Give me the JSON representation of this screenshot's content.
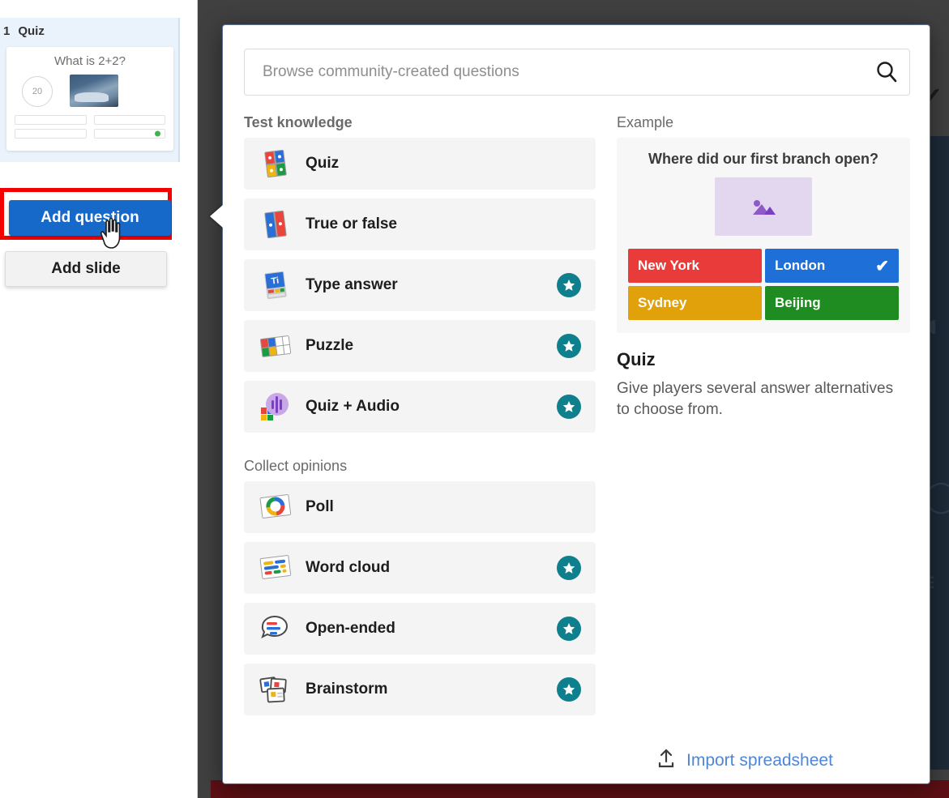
{
  "background": {
    "check_glyph": "✓",
    "glyph1": "◐",
    "glyph2": "◯",
    "glyph3": "≡"
  },
  "sidebar": {
    "slide": {
      "number": "1",
      "type": "Quiz",
      "thumbnail_question": "What is 2+2?",
      "timer": "20"
    },
    "add_question_label": "Add question",
    "add_slide_label": "Add slide"
  },
  "modal": {
    "search": {
      "placeholder": "Browse community-created questions",
      "value": "",
      "icon": "search-icon"
    },
    "sections": [
      {
        "heading": "Test knowledge",
        "items": [
          {
            "label": "Quiz",
            "icon": "quiz-tiles-icon",
            "premium": false
          },
          {
            "label": "True or false",
            "icon": "true-false-tiles-icon",
            "premium": false
          },
          {
            "label": "Type answer",
            "icon": "type-answer-icon",
            "premium": true
          },
          {
            "label": "Puzzle",
            "icon": "puzzle-tiles-icon",
            "premium": true
          },
          {
            "label": "Quiz + Audio",
            "icon": "audio-wave-icon",
            "premium": true
          }
        ]
      },
      {
        "heading": "Collect opinions",
        "items": [
          {
            "label": "Poll",
            "icon": "poll-donut-icon",
            "premium": false
          },
          {
            "label": "Word cloud",
            "icon": "word-cloud-icon",
            "premium": true
          },
          {
            "label": "Open-ended",
            "icon": "speech-bubble-icon",
            "premium": true
          },
          {
            "label": "Brainstorm",
            "icon": "sticky-notes-icon",
            "premium": true
          }
        ]
      }
    ],
    "preview": {
      "heading": "Example",
      "question": "Where did our first branch open?",
      "image_placeholder_icon": "image-placeholder-icon",
      "answers": [
        {
          "label": "New York",
          "color": "#ea3b3b",
          "correct": false
        },
        {
          "label": "London",
          "color": "#1f6fd8",
          "correct": true
        },
        {
          "label": "Sydney",
          "color": "#e0a10a",
          "correct": false
        },
        {
          "label": "Beijing",
          "color": "#1e8c20",
          "correct": false
        }
      ],
      "correct_mark": "✔",
      "title": "Quiz",
      "description": "Give players several answer alternatives to choose from."
    },
    "import": {
      "label": "Import spreadsheet",
      "icon": "upload-icon"
    }
  },
  "colors": {
    "primary_blue": "#1669c8",
    "premium_teal": "#0e7f8c",
    "highlight_red": "#f50000",
    "link_blue": "#4f86d6"
  }
}
